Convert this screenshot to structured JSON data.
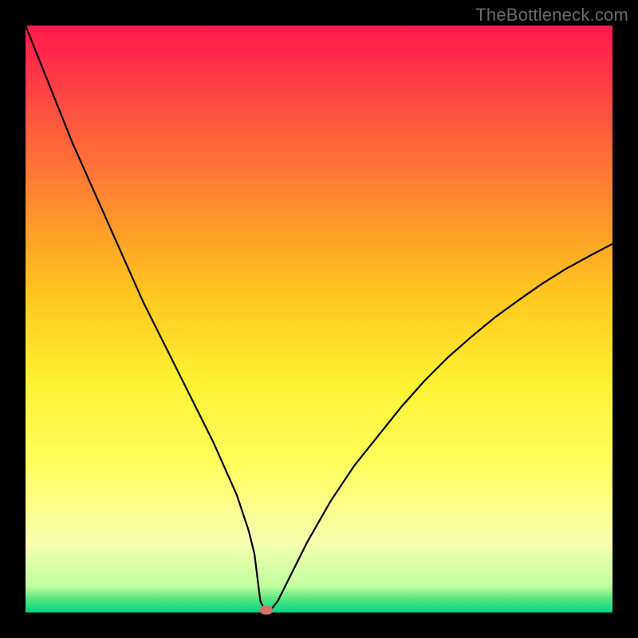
{
  "watermark": "TheBottleneck.com",
  "marker": {
    "color": "#cf766b"
  },
  "chart_data": {
    "type": "line",
    "title": "",
    "xlabel": "",
    "ylabel": "",
    "xlim": [
      0,
      100
    ],
    "ylim": [
      0,
      100
    ],
    "gradient_stops": [
      {
        "pos": 0.0,
        "color": "#ff1a4b"
      },
      {
        "pos": 0.05,
        "color": "#ff2a49"
      },
      {
        "pos": 0.15,
        "color": "#ff5240"
      },
      {
        "pos": 0.3,
        "color": "#ff8a30"
      },
      {
        "pos": 0.45,
        "color": "#ffc41e"
      },
      {
        "pos": 0.6,
        "color": "#fff030"
      },
      {
        "pos": 0.75,
        "color": "#ffff60"
      },
      {
        "pos": 0.88,
        "color": "#f8ffb0"
      },
      {
        "pos": 0.955,
        "color": "#c0ffa0"
      },
      {
        "pos": 0.975,
        "color": "#60e880"
      },
      {
        "pos": 1.0,
        "color": "#00d486"
      }
    ],
    "series": [
      {
        "name": "bottleneck-curve",
        "x": [
          0,
          4,
          8,
          12,
          16,
          20,
          24,
          28,
          32,
          36,
          38,
          39,
          39.5,
          40,
          40.7,
          41.3,
          42,
          43,
          45,
          48,
          52,
          56,
          60,
          64,
          68,
          72,
          76,
          80,
          84,
          88,
          92,
          96,
          100
        ],
        "y": [
          100,
          90,
          80,
          71,
          62,
          53,
          45,
          37,
          29,
          20,
          14,
          10,
          6,
          2,
          0.5,
          0.4,
          0.7,
          2,
          6,
          12,
          19,
          25,
          30,
          35,
          39.5,
          43.5,
          47,
          50.3,
          53.2,
          56,
          58.5,
          60.7,
          62.8
        ]
      }
    ],
    "marker_point": {
      "x": 41,
      "y": 0.4
    }
  }
}
